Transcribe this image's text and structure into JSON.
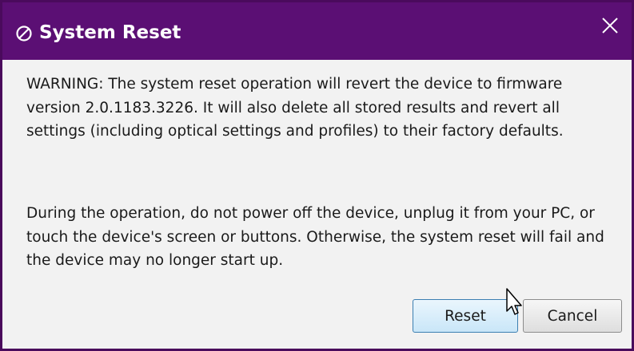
{
  "dialog": {
    "title": "System Reset",
    "title_icon": "circle-slash-icon",
    "close_icon": "close-icon",
    "message_paragraph_1": "WARNING: The system reset operation will revert the device to firmware version 2.0.1183.3226. It will also delete all stored results and revert all settings (including optical settings and profiles) to their factory defaults.",
    "message_paragraph_2": "During the operation, do not power off the device, unplug it from your PC, or touch the device's screen or buttons. Otherwise, the system reset will fail and the device may no longer start up.",
    "buttons": {
      "reset_label": "Reset",
      "cancel_label": "Cancel"
    }
  },
  "colors": {
    "titlebar": "#5b0f74",
    "border": "#4a0a5c",
    "body_background": "#f2f2f2"
  }
}
